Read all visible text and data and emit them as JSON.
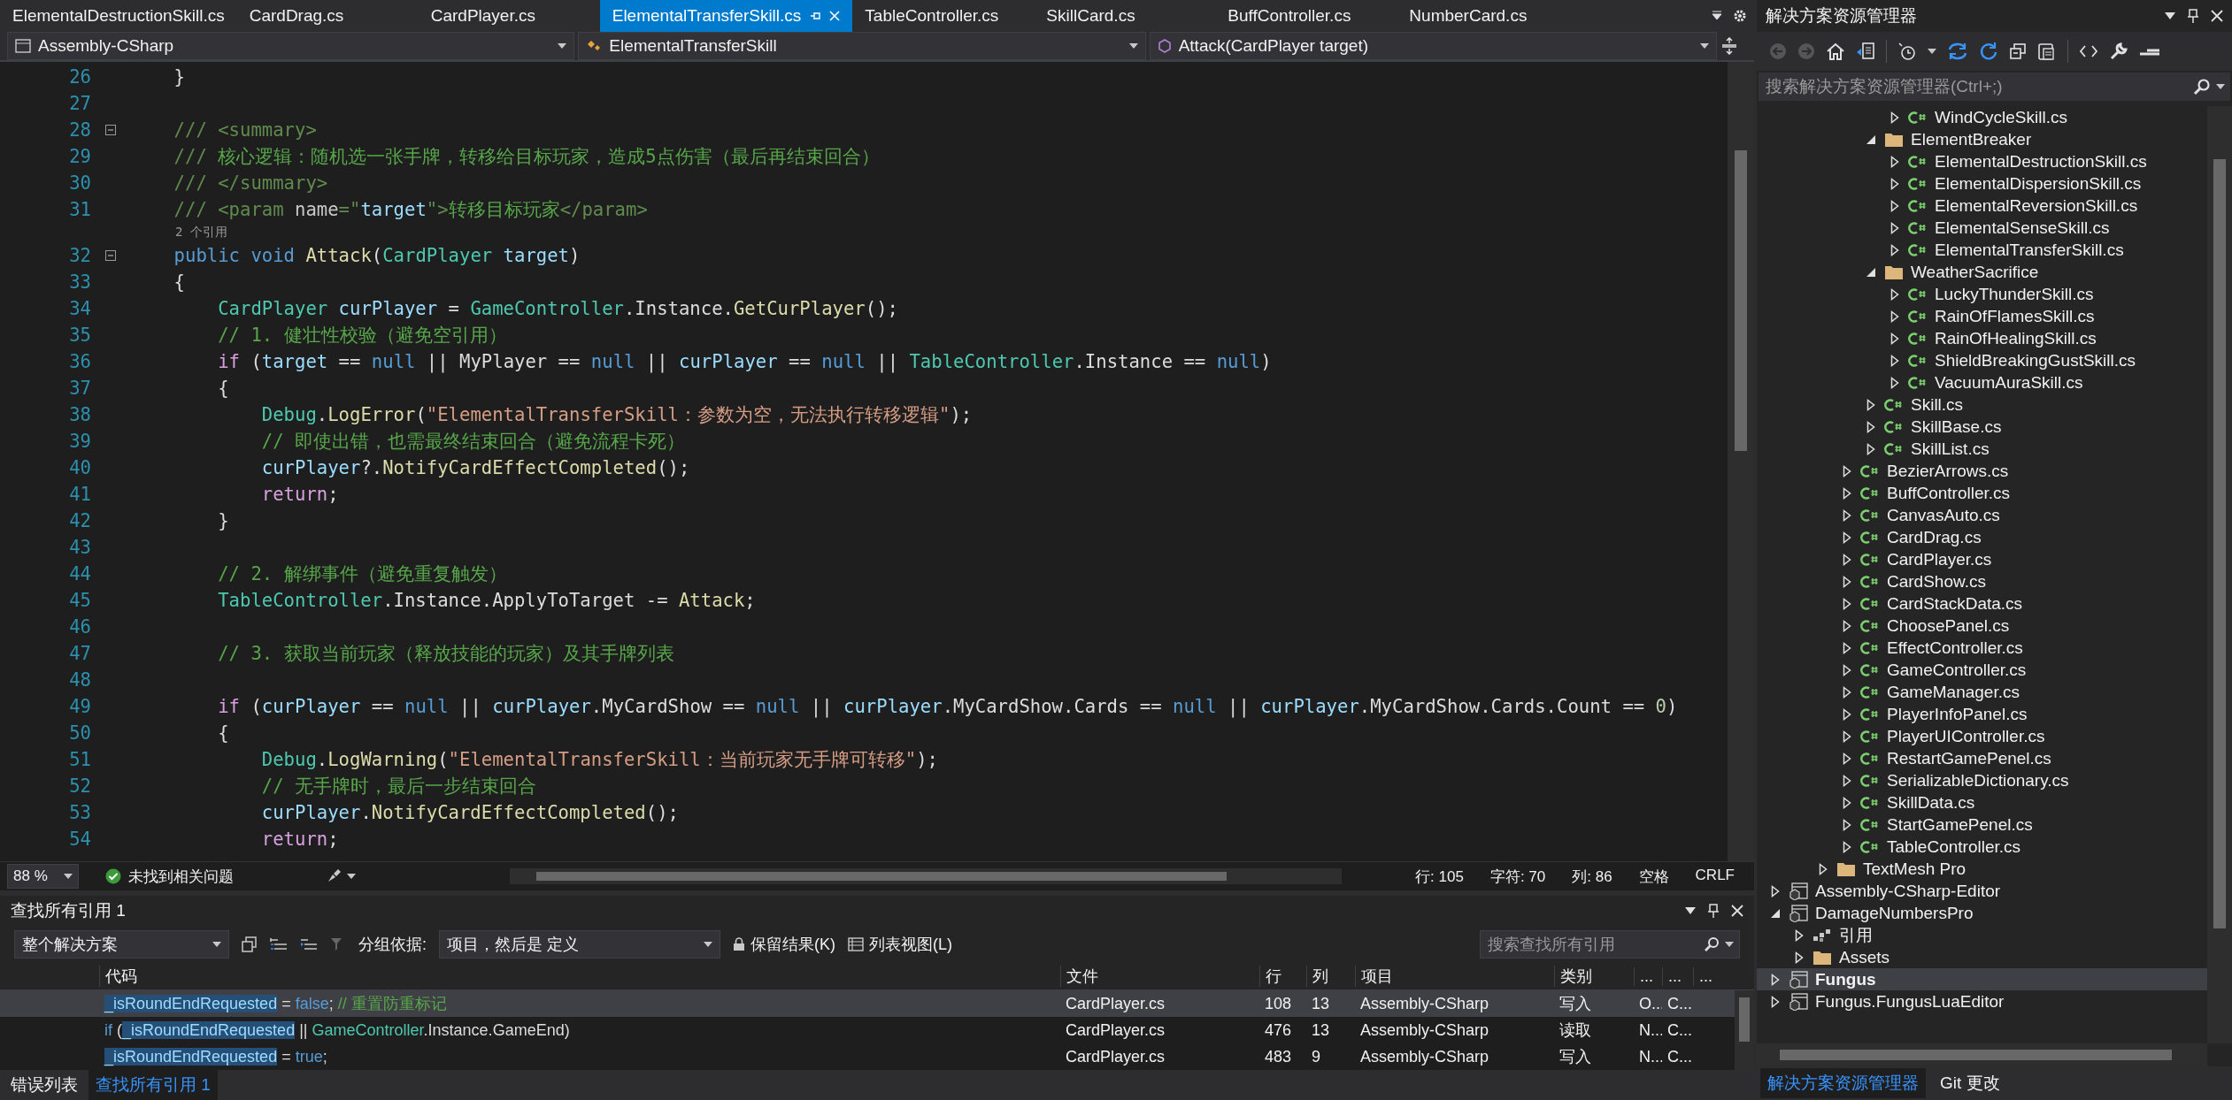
{
  "editor_tabs": [
    {
      "label": "ElementalDestructionSkill.cs",
      "selected": false
    },
    {
      "label": "CardDrag.cs",
      "selected": false
    },
    {
      "label": "CardPlayer.cs",
      "selected": false
    },
    {
      "label": "ElementalTransferSkill.cs",
      "selected": true
    },
    {
      "label": "TableController.cs",
      "selected": false
    },
    {
      "label": "SkillCard.cs",
      "selected": false
    },
    {
      "label": "BuffController.cs",
      "selected": false
    },
    {
      "label": "NumberCard.cs",
      "selected": false
    }
  ],
  "navbar": {
    "project": "Assembly-CSharp",
    "type": "ElementalTransferSkill",
    "member": "Attack(CardPlayer target)"
  },
  "code_lines": [
    {
      "kind": "line",
      "n": "26",
      "fold": false,
      "code": [
        {
          "kind": "plain",
          "text": "    }"
        }
      ]
    },
    {
      "kind": "line",
      "n": "27",
      "fold": false
    },
    {
      "kind": "line",
      "n": "28",
      "fold": true,
      "code": [
        {
          "kind": "doc",
          "text": "    /// <summary>"
        }
      ]
    },
    {
      "kind": "line",
      "n": "29",
      "fold": false,
      "code": [
        {
          "kind": "doc",
          "text": "    /// "
        },
        {
          "kind": "comment",
          "text": "核心逻辑：随机选一张手牌，转移给目标玩家，造成5点伤害（最后再结束回合）"
        }
      ]
    },
    {
      "kind": "line",
      "n": "30",
      "fold": false,
      "code": [
        {
          "kind": "doc",
          "text": "    /// </summary>"
        }
      ]
    },
    {
      "kind": "line",
      "n": "31",
      "fold": false,
      "code": [
        {
          "kind": "doc",
          "text": "    /// <param "
        },
        {
          "kind": "attr",
          "text": "name"
        },
        {
          "kind": "doc",
          "text": "=\""
        },
        {
          "kind": "variable",
          "text": "target"
        },
        {
          "kind": "doc",
          "text": "\">"
        },
        {
          "kind": "comment",
          "text": "转移目标玩家"
        },
        {
          "kind": "doc",
          "text": "</param>"
        }
      ]
    },
    {
      "kind": "lens",
      "text": "2 个引用"
    },
    {
      "kind": "line",
      "n": "32",
      "fold": true,
      "code": [
        {
          "kind": "keyword",
          "text": "    public void "
        },
        {
          "kind": "method",
          "text": "Attack"
        },
        {
          "kind": "plain",
          "text": "("
        },
        {
          "kind": "type",
          "text": "CardPlayer "
        },
        {
          "kind": "variable",
          "text": "target"
        },
        {
          "kind": "plain",
          "text": ")"
        }
      ]
    },
    {
      "kind": "line",
      "n": "33",
      "fold": false,
      "code": [
        {
          "kind": "plain",
          "text": "    {"
        }
      ]
    },
    {
      "kind": "line",
      "n": "34",
      "fold": false,
      "code": [
        {
          "kind": "type",
          "text": "        CardPlayer "
        },
        {
          "kind": "variable",
          "text": "curPlayer"
        },
        {
          "kind": "plain",
          "text": " = "
        },
        {
          "kind": "type",
          "text": "GameController"
        },
        {
          "kind": "plain",
          "text": ".Instance."
        },
        {
          "kind": "method",
          "text": "GetCurPlayer"
        },
        {
          "kind": "plain",
          "text": "();"
        }
      ]
    },
    {
      "kind": "line",
      "n": "35",
      "fold": false,
      "code": [
        {
          "kind": "comment",
          "text": "        // 1. 健壮性校验（避免空引用）"
        }
      ]
    },
    {
      "kind": "line",
      "n": "36",
      "fold": false,
      "code": [
        {
          "kind": "control",
          "text": "        if"
        },
        {
          "kind": "plain",
          "text": " ("
        },
        {
          "kind": "variable",
          "text": "target"
        },
        {
          "kind": "plain",
          "text": " == "
        },
        {
          "kind": "keyword",
          "text": "null"
        },
        {
          "kind": "plain",
          "text": " || MyPlayer == "
        },
        {
          "kind": "keyword",
          "text": "null"
        },
        {
          "kind": "plain",
          "text": " || "
        },
        {
          "kind": "variable",
          "text": "curPlayer"
        },
        {
          "kind": "plain",
          "text": " == "
        },
        {
          "kind": "keyword",
          "text": "null"
        },
        {
          "kind": "plain",
          "text": " || "
        },
        {
          "kind": "type",
          "text": "TableController"
        },
        {
          "kind": "plain",
          "text": ".Instance == "
        },
        {
          "kind": "keyword",
          "text": "null"
        },
        {
          "kind": "plain",
          "text": ")"
        }
      ]
    },
    {
      "kind": "line",
      "n": "37",
      "fold": false,
      "code": [
        {
          "kind": "plain",
          "text": "        {"
        }
      ]
    },
    {
      "kind": "line",
      "n": "38",
      "fold": false,
      "code": [
        {
          "kind": "type",
          "text": "            Debug"
        },
        {
          "kind": "plain",
          "text": "."
        },
        {
          "kind": "method",
          "text": "LogError"
        },
        {
          "kind": "plain",
          "text": "("
        },
        {
          "kind": "string",
          "text": "\"ElementalTransferSkill：参数为空，无法执行转移逻辑\""
        },
        {
          "kind": "plain",
          "text": ");"
        }
      ]
    },
    {
      "kind": "line",
      "n": "39",
      "fold": false,
      "code": [
        {
          "kind": "comment",
          "text": "            // 即使出错，也需最终结束回合（避免流程卡死）"
        }
      ]
    },
    {
      "kind": "line",
      "n": "40",
      "fold": false,
      "code": [
        {
          "kind": "variable",
          "text": "            curPlayer"
        },
        {
          "kind": "plain",
          "text": "?."
        },
        {
          "kind": "method",
          "text": "NotifyCardEffectCompleted"
        },
        {
          "kind": "plain",
          "text": "();"
        }
      ]
    },
    {
      "kind": "line",
      "n": "41",
      "fold": false,
      "code": [
        {
          "kind": "control",
          "text": "            return"
        },
        {
          "kind": "plain",
          "text": ";"
        }
      ]
    },
    {
      "kind": "line",
      "n": "42",
      "fold": false,
      "code": [
        {
          "kind": "plain",
          "text": "        }"
        }
      ]
    },
    {
      "kind": "line",
      "n": "43",
      "fold": false
    },
    {
      "kind": "line",
      "n": "44",
      "fold": false,
      "code": [
        {
          "kind": "comment",
          "text": "        // 2. 解绑事件（避免重复触发）"
        }
      ]
    },
    {
      "kind": "line",
      "n": "45",
      "fold": false,
      "code": [
        {
          "kind": "type",
          "text": "        TableController"
        },
        {
          "kind": "plain",
          "text": ".Instance.ApplyToTarget -= "
        },
        {
          "kind": "method",
          "text": "Attack"
        },
        {
          "kind": "plain",
          "text": ";"
        }
      ]
    },
    {
      "kind": "line",
      "n": "46",
      "fold": false
    },
    {
      "kind": "line",
      "n": "47",
      "fold": false,
      "code": [
        {
          "kind": "comment",
          "text": "        // 3. 获取当前玩家（释放技能的玩家）及其手牌列表"
        }
      ]
    },
    {
      "kind": "line",
      "n": "48",
      "fold": false
    },
    {
      "kind": "line",
      "n": "49",
      "fold": false,
      "code": [
        {
          "kind": "control",
          "text": "        if"
        },
        {
          "kind": "plain",
          "text": " ("
        },
        {
          "kind": "variable",
          "text": "curPlayer"
        },
        {
          "kind": "plain",
          "text": " == "
        },
        {
          "kind": "keyword",
          "text": "null"
        },
        {
          "kind": "plain",
          "text": " || "
        },
        {
          "kind": "variable",
          "text": "curPlayer"
        },
        {
          "kind": "plain",
          "text": ".MyCardShow == "
        },
        {
          "kind": "keyword",
          "text": "null"
        },
        {
          "kind": "plain",
          "text": " || "
        },
        {
          "kind": "variable",
          "text": "curPlayer"
        },
        {
          "kind": "plain",
          "text": ".MyCardShow.Cards == "
        },
        {
          "kind": "keyword",
          "text": "null"
        },
        {
          "kind": "plain",
          "text": " || "
        },
        {
          "kind": "variable",
          "text": "curPlayer"
        },
        {
          "kind": "plain",
          "text": ".MyCardShow.Cards.Count == "
        },
        {
          "kind": "number",
          "text": "0"
        },
        {
          "kind": "plain",
          "text": ")"
        }
      ]
    },
    {
      "kind": "line",
      "n": "50",
      "fold": false,
      "code": [
        {
          "kind": "plain",
          "text": "        {"
        }
      ]
    },
    {
      "kind": "line",
      "n": "51",
      "fold": false,
      "code": [
        {
          "kind": "type",
          "text": "            Debug"
        },
        {
          "kind": "plain",
          "text": "."
        },
        {
          "kind": "method",
          "text": "LogWarning"
        },
        {
          "kind": "plain",
          "text": "("
        },
        {
          "kind": "string",
          "text": "\"ElementalTransferSkill：当前玩家无手牌可转移\""
        },
        {
          "kind": "plain",
          "text": ");"
        }
      ]
    },
    {
      "kind": "line",
      "n": "52",
      "fold": false,
      "code": [
        {
          "kind": "comment",
          "text": "            // 无手牌时，最后一步结束回合"
        }
      ]
    },
    {
      "kind": "line",
      "n": "53",
      "fold": false,
      "code": [
        {
          "kind": "variable",
          "text": "            curPlayer"
        },
        {
          "kind": "plain",
          "text": "."
        },
        {
          "kind": "method",
          "text": "NotifyCardEffectCompleted"
        },
        {
          "kind": "plain",
          "text": "();"
        }
      ]
    },
    {
      "kind": "line",
      "n": "54",
      "fold": false,
      "code": [
        {
          "kind": "control",
          "text": "            return"
        },
        {
          "kind": "plain",
          "text": ";"
        }
      ]
    }
  ],
  "status_bar": {
    "zoom": "88 %",
    "issues": "未找到相关问题",
    "position": [
      "行: 105",
      "字符: 70",
      "列: 86",
      "空格",
      "CRLF"
    ]
  },
  "find_panel": {
    "title": "查找所有引用 1",
    "scope": "整个解决方案",
    "group_label": "分组依据:",
    "group_by": "项目，然后是 定义",
    "keep_results": "保留结果(K)",
    "list_view": "列表视图(L)",
    "search": {
      "placeholder": "搜索查找所有引用"
    },
    "columns": [
      "代码",
      "文件",
      "行",
      "列",
      "项目",
      "类别",
      "...",
      "...",
      "..."
    ],
    "rows": [
      {
        "selected": true,
        "cells": [
          [
            {
              "kind": "highlight",
              "text": "_isRoundEndRequested"
            },
            {
              "kind": "plain",
              "text": " = "
            },
            {
              "kind": "keyword",
              "text": "false"
            },
            {
              "kind": "plain",
              "text": "; "
            },
            {
              "kind": "comment",
              "text": "// 重置防重标记"
            }
          ],
          "CardPlayer.cs",
          "108",
          "13",
          "Assembly-CSharp",
          "写入",
          "O...",
          "C..."
        ]
      },
      {
        "selected": false,
        "cells": [
          [
            {
              "kind": "keyword",
              "text": "if"
            },
            {
              "kind": "plain",
              "text": " ("
            },
            {
              "kind": "highlight",
              "text": "_isRoundEndRequested"
            },
            {
              "kind": "plain",
              "text": " || "
            },
            {
              "kind": "type",
              "text": "GameController"
            },
            {
              "kind": "plain",
              "text": ".Instance.GameEnd)"
            }
          ],
          "CardPlayer.cs",
          "476",
          "13",
          "Assembly-CSharp",
          "读取",
          "N...",
          "C..."
        ]
      },
      {
        "selected": false,
        "cells": [
          [
            {
              "kind": "highlight",
              "text": "_isRoundEndRequested"
            },
            {
              "kind": "plain",
              "text": " = "
            },
            {
              "kind": "keyword",
              "text": "true"
            },
            {
              "kind": "plain",
              "text": ";"
            }
          ],
          "CardPlayer.cs",
          "483",
          "9",
          "Assembly-CSharp",
          "写入",
          "N...",
          "C..."
        ]
      }
    ]
  },
  "bottom_tabs": [
    {
      "label": "错误列表",
      "selected": false
    },
    {
      "label": "查找所有引用 1",
      "selected": true
    }
  ],
  "explorer": {
    "title": "解决方案资源管理器",
    "search": {
      "placeholder": "搜索解决方案资源管理器(Ctrl+;)"
    },
    "tree": [
      {
        "children": [
          {
            "children": [
              {
                "children": [
                  {
                    "children": [
                      {
                        "children": [
                          {
                            "label": "WindCycleSkill.cs",
                            "kind": "cs",
                            "expanded": false,
                            "selected": false
                          }
                        ]
                      },
                      {
                        "label": "ElementBreaker",
                        "kind": "folder",
                        "expanded": true,
                        "selected": false,
                        "children": [
                          {
                            "label": "ElementalDestructionSkill.cs",
                            "kind": "cs",
                            "expanded": false,
                            "selected": false
                          },
                          {
                            "label": "ElementalDispersionSkill.cs",
                            "kind": "cs",
                            "expanded": false,
                            "selected": false
                          },
                          {
                            "label": "ElementalReversionSkill.cs",
                            "kind": "cs",
                            "expanded": false,
                            "selected": false
                          },
                          {
                            "label": "ElementalSenseSkill.cs",
                            "kind": "cs",
                            "expanded": false,
                            "selected": false
                          },
                          {
                            "label": "ElementalTransferSkill.cs",
                            "kind": "cs",
                            "expanded": false,
                            "selected": false
                          }
                        ]
                      },
                      {
                        "label": "WeatherSacrifice",
                        "kind": "folder",
                        "expanded": true,
                        "selected": false,
                        "children": [
                          {
                            "label": "LuckyThunderSkill.cs",
                            "kind": "cs",
                            "expanded": false,
                            "selected": false
                          },
                          {
                            "label": "RainOfFlamesSkill.cs",
                            "kind": "cs",
                            "expanded": false,
                            "selected": false
                          },
                          {
                            "label": "RainOfHealingSkill.cs",
                            "kind": "cs",
                            "expanded": false,
                            "selected": false
                          },
                          {
                            "label": "ShieldBreakingGustSkill.cs",
                            "kind": "cs",
                            "expanded": false,
                            "selected": false
                          },
                          {
                            "label": "VacuumAuraSkill.cs",
                            "kind": "cs",
                            "expanded": false,
                            "selected": false
                          }
                        ]
                      },
                      {
                        "label": "Skill.cs",
                        "kind": "cs",
                        "expanded": false,
                        "selected": false
                      },
                      {
                        "label": "SkillBase.cs",
                        "kind": "cs",
                        "expanded": false,
                        "selected": false
                      },
                      {
                        "label": "SkillList.cs",
                        "kind": "cs",
                        "expanded": false,
                        "selected": false
                      }
                    ]
                  },
                  {
                    "label": "BezierArrows.cs",
                    "kind": "cs",
                    "expanded": false,
                    "selected": false
                  },
                  {
                    "label": "BuffController.cs",
                    "kind": "cs",
                    "expanded": false,
                    "selected": false
                  },
                  {
                    "label": "CanvasAuto.cs",
                    "kind": "cs",
                    "expanded": false,
                    "selected": false
                  },
                  {
                    "label": "CardDrag.cs",
                    "kind": "cs",
                    "expanded": false,
                    "selected": false
                  },
                  {
                    "label": "CardPlayer.cs",
                    "kind": "cs",
                    "expanded": false,
                    "selected": false
                  },
                  {
                    "label": "CardShow.cs",
                    "kind": "cs",
                    "expanded": false,
                    "selected": false
                  },
                  {
                    "label": "CardStackData.cs",
                    "kind": "cs",
                    "expanded": false,
                    "selected": false
                  },
                  {
                    "label": "ChoosePanel.cs",
                    "kind": "cs",
                    "expanded": false,
                    "selected": false
                  },
                  {
                    "label": "EffectController.cs",
                    "kind": "cs",
                    "expanded": false,
                    "selected": false
                  },
                  {
                    "label": "GameController.cs",
                    "kind": "cs",
                    "expanded": false,
                    "selected": false
                  },
                  {
                    "label": "GameManager.cs",
                    "kind": "cs",
                    "expanded": false,
                    "selected": false
                  },
                  {
                    "label": "PlayerInfoPanel.cs",
                    "kind": "cs",
                    "expanded": false,
                    "selected": false
                  },
                  {
                    "label": "PlayerUIController.cs",
                    "kind": "cs",
                    "expanded": false,
                    "selected": false
                  },
                  {
                    "label": "RestartGamePenel.cs",
                    "kind": "cs",
                    "expanded": false,
                    "selected": false
                  },
                  {
                    "label": "SerializableDictionary.cs",
                    "kind": "cs",
                    "expanded": false,
                    "selected": false
                  },
                  {
                    "label": "SkillData.cs",
                    "kind": "cs",
                    "expanded": false,
                    "selected": false
                  },
                  {
                    "label": "StartGamePenel.cs",
                    "kind": "cs",
                    "expanded": false,
                    "selected": false
                  },
                  {
                    "label": "TableController.cs",
                    "kind": "cs",
                    "expanded": false,
                    "selected": false
                  }
                ]
              },
              {
                "label": "TextMesh Pro",
                "kind": "folder",
                "expanded": false,
                "selected": false
              }
            ]
          }
        ]
      },
      {
        "label": "Assembly-CSharp-Editor",
        "kind": "project",
        "expanded": false,
        "selected": false
      },
      {
        "label": "DamageNumbersPro",
        "kind": "project",
        "expanded": true,
        "selected": false,
        "children": [
          {
            "label": "引用",
            "kind": "refs",
            "expanded": false,
            "selected": false
          },
          {
            "label": "Assets",
            "kind": "folder",
            "expanded": false,
            "selected": false
          }
        ]
      },
      {
        "label": "Fungus",
        "kind": "project",
        "expanded": false,
        "selected": true
      },
      {
        "label": "Fungus.FungusLuaEditor",
        "kind": "project",
        "expanded": false,
        "selected": false
      }
    ],
    "tabs": [
      {
        "label": "解决方案资源管理器",
        "selected": true
      },
      {
        "label": "Git 更改",
        "selected": false
      }
    ]
  }
}
